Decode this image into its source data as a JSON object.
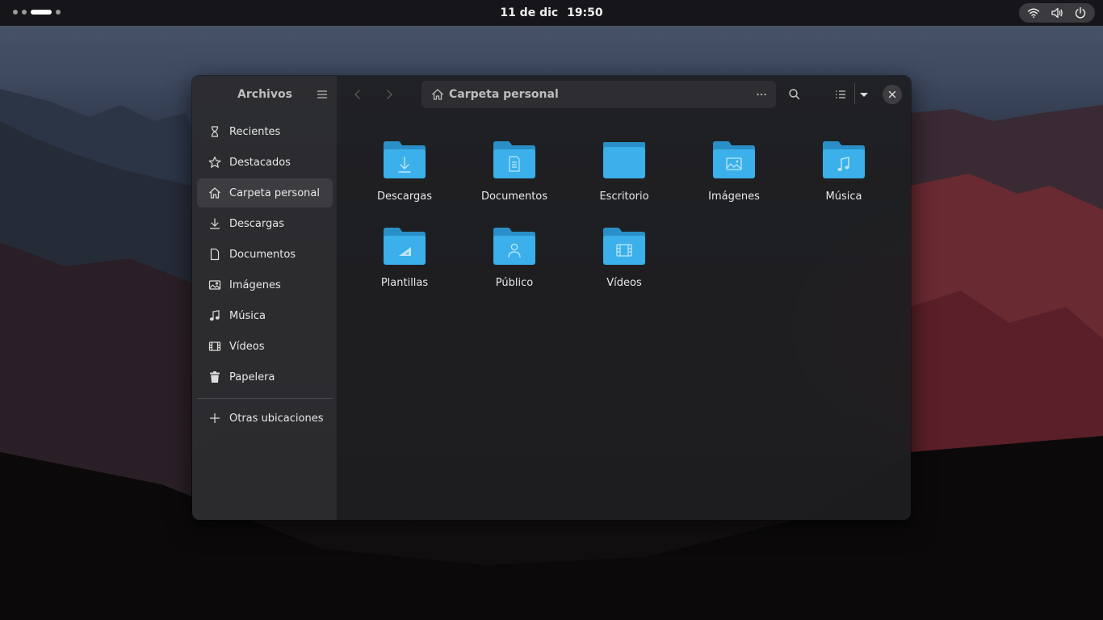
{
  "topbar": {
    "date": "11 de dic",
    "time": "19:50",
    "tray_icons": [
      "wifi-icon",
      "volume-icon",
      "power-icon"
    ]
  },
  "window": {
    "sidebar": {
      "title": "Archivos",
      "items": [
        {
          "label": "Recientes",
          "icon": "clock-icon"
        },
        {
          "label": "Destacados",
          "icon": "star-icon"
        },
        {
          "label": "Carpeta personal",
          "icon": "home-icon",
          "active": true
        },
        {
          "label": "Descargas",
          "icon": "download-icon"
        },
        {
          "label": "Documentos",
          "icon": "document-icon"
        },
        {
          "label": "Imágenes",
          "icon": "image-icon"
        },
        {
          "label": "Música",
          "icon": "music-icon"
        },
        {
          "label": "Vídeos",
          "icon": "video-icon"
        },
        {
          "label": "Papelera",
          "icon": "trash-icon"
        }
      ],
      "other_locations": "Otras ubicaciones"
    },
    "header": {
      "path": "Carpeta personal"
    },
    "folders": [
      {
        "name": "Descargas",
        "emblem": "download"
      },
      {
        "name": "Documentos",
        "emblem": "document"
      },
      {
        "name": "Escritorio",
        "emblem": "desktop"
      },
      {
        "name": "Imágenes",
        "emblem": "image"
      },
      {
        "name": "Música",
        "emblem": "music"
      },
      {
        "name": "Plantillas",
        "emblem": "template"
      },
      {
        "name": "Público",
        "emblem": "person"
      },
      {
        "name": "Vídeos",
        "emblem": "video"
      }
    ],
    "colors": {
      "folder_front": "#3bb0ea",
      "folder_back": "#2b8fc7",
      "emblem": "#bfe6fa"
    }
  }
}
